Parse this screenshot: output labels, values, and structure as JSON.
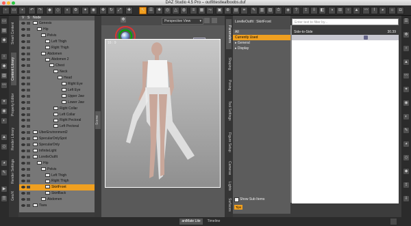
{
  "window": {
    "title": "DAZ Studio 4.5 Pro – outfittestleafboobs.duf"
  },
  "scene": {
    "header": {
      "v": "V",
      "s": "S",
      "node": "Node"
    },
    "rows": [
      {
        "label": "Genesis",
        "indent": 0
      },
      {
        "label": "Hip",
        "indent": 1
      },
      {
        "label": "Pelvis",
        "indent": 2
      },
      {
        "label": "Left Thigh",
        "indent": 3
      },
      {
        "label": "Right Thigh",
        "indent": 3
      },
      {
        "label": "Abdomen",
        "indent": 2
      },
      {
        "label": "Abdomen 2",
        "indent": 3
      },
      {
        "label": "Chest",
        "indent": 4
      },
      {
        "label": "Neck",
        "indent": 5
      },
      {
        "label": "Head",
        "indent": 6
      },
      {
        "label": "Right Eye",
        "indent": 7
      },
      {
        "label": "Left Eye",
        "indent": 7
      },
      {
        "label": "Upper Jaw",
        "indent": 7
      },
      {
        "label": "Lower Jaw",
        "indent": 7
      },
      {
        "label": "Right Collar",
        "indent": 5
      },
      {
        "label": "Left Collar",
        "indent": 5
      },
      {
        "label": "Right Pectoral",
        "indent": 5
      },
      {
        "label": "Left Pectoral",
        "indent": 5
      },
      {
        "label": "UberEnvironment2",
        "indent": 0
      },
      {
        "label": "SpecularOnlySpot",
        "indent": 0
      },
      {
        "label": "SpecularOnly",
        "indent": 0
      },
      {
        "label": "InfiniteLight",
        "indent": 0
      },
      {
        "label": "LorelleOutfit",
        "indent": 0
      },
      {
        "label": "Hip",
        "indent": 1
      },
      {
        "label": "Pelvis",
        "indent": 2
      },
      {
        "label": "Left Thigh",
        "indent": 3
      },
      {
        "label": "Right Thigh",
        "indent": 3
      },
      {
        "label": "SkirtFront",
        "indent": 3,
        "selected": true
      },
      {
        "label": "SkirtBack",
        "indent": 3
      },
      {
        "label": "Abdomen",
        "indent": 2
      },
      {
        "label": "Tiara",
        "indent": 0
      }
    ]
  },
  "left_tabs": [
    "Smart Content",
    "Content Library",
    "Property Editor",
    "Render Library",
    "Render Settings",
    "Geo/X"
  ],
  "viewport": {
    "camera": "Perspective View",
    "side_tab": "Scene",
    "canvas_label": "16 : 9"
  },
  "params": {
    "node_title": "LorelleOutfit : SkirtFront",
    "filter_placeholder": "Enter text to filter by...",
    "categories": [
      {
        "label": "All",
        "active": false
      },
      {
        "label": "Currently Used",
        "active": true
      },
      {
        "label": "General",
        "active": false
      },
      {
        "label": "Display",
        "active": false
      }
    ],
    "show_sub_items": "Show Sub Items",
    "tips_label": "Tips",
    "slider": {
      "label": "Side-to-Side",
      "value": "30.39",
      "fraction": 0.7
    }
  },
  "right_tabs": [
    "Parameters",
    "Shaping",
    "Posing",
    "Tool Settings",
    "Figure Setup",
    "Cameras",
    "Lights",
    "Surfaces"
  ],
  "bottom_tabs": [
    "aniMate Lite",
    "Timeline"
  ],
  "colors": {
    "accent": "#f0a020",
    "panel": "#5c5c5c"
  }
}
